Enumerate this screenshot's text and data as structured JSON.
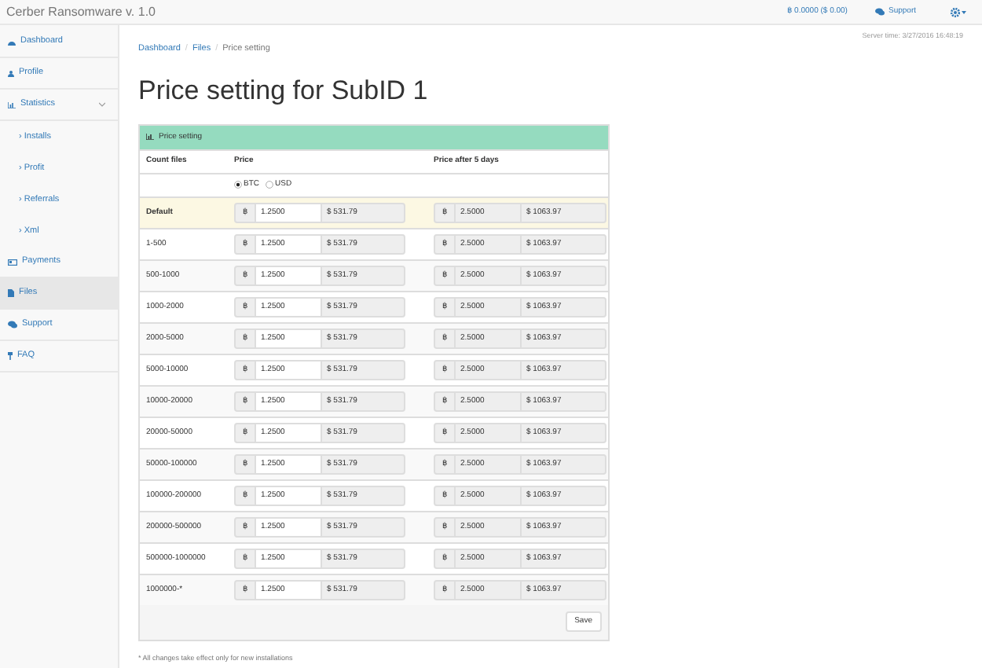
{
  "topbar": {
    "title": "Cerber Ransomware v. 1.0",
    "balance": "฿ 0.0000  ($ 0.00)",
    "support": "Support"
  },
  "sidebar": {
    "items": [
      {
        "label": "Dashboard",
        "selected": false
      },
      {
        "label": "Profile",
        "selected": false
      },
      {
        "label": "Statistics",
        "selected": false,
        "expanded": true,
        "children": [
          {
            "label": "› Installs",
            "selected": false
          },
          {
            "label": "› Profit",
            "selected": false
          },
          {
            "label": "› Referrals",
            "selected": false
          },
          {
            "label": "› Xml",
            "selected": false
          }
        ]
      },
      {
        "label": "Payments",
        "selected": false
      },
      {
        "label": "Files",
        "selected": true
      },
      {
        "label": "Support",
        "selected": false
      },
      {
        "label": "FAQ",
        "selected": false
      }
    ]
  },
  "breadcrumb": [
    {
      "label": "Dashboard",
      "link": true
    },
    {
      "label": "Files",
      "link": true
    },
    {
      "label": "Price setting",
      "link": false
    }
  ],
  "breadcrumb_separators": [
    "/",
    "/"
  ],
  "server_time": "Server time: 3/27/2016  16:48:19",
  "heading": "Price setting for SubID 1",
  "panel": {
    "title": "Price setting",
    "columns": [
      "Count files",
      "Price",
      "Price after 5 days"
    ],
    "currency": [
      {
        "label": "BTC",
        "selected": true
      },
      {
        "label": "USD",
        "selected": false
      }
    ],
    "rows": [
      {
        "count": "Default",
        "highlighted": true,
        "btc_sign": "฿",
        "price": "1.2500",
        "usd": "$ 531.79",
        "btc_sign_after": "฿",
        "price_after": "2.5000",
        "usd_after": "$ 1063.97"
      },
      {
        "count": "1-500",
        "highlighted": false,
        "btc_sign": "฿",
        "price": "1.2500",
        "usd": "$ 531.79",
        "btc_sign_after": "฿",
        "price_after": "2.5000",
        "usd_after": "$ 1063.97"
      },
      {
        "count": "500-1000",
        "highlighted": false,
        "btc_sign": "฿",
        "price": "1.2500",
        "usd": "$ 531.79",
        "btc_sign_after": "฿",
        "price_after": "2.5000",
        "usd_after": "$ 1063.97"
      },
      {
        "count": "1000-2000",
        "highlighted": false,
        "btc_sign": "฿",
        "price": "1.2500",
        "usd": "$ 531.79",
        "btc_sign_after": "฿",
        "price_after": "2.5000",
        "usd_after": "$ 1063.97"
      },
      {
        "count": "2000-5000",
        "highlighted": false,
        "btc_sign": "฿",
        "price": "1.2500",
        "usd": "$ 531.79",
        "btc_sign_after": "฿",
        "price_after": "2.5000",
        "usd_after": "$ 1063.97"
      },
      {
        "count": "5000-10000",
        "highlighted": false,
        "btc_sign": "฿",
        "price": "1.2500",
        "usd": "$ 531.79",
        "btc_sign_after": "฿",
        "price_after": "2.5000",
        "usd_after": "$ 1063.97"
      },
      {
        "count": "10000-20000",
        "highlighted": false,
        "btc_sign": "฿",
        "price": "1.2500",
        "usd": "$ 531.79",
        "btc_sign_after": "฿",
        "price_after": "2.5000",
        "usd_after": "$ 1063.97"
      },
      {
        "count": "20000-50000",
        "highlighted": false,
        "btc_sign": "฿",
        "price": "1.2500",
        "usd": "$ 531.79",
        "btc_sign_after": "฿",
        "price_after": "2.5000",
        "usd_after": "$ 1063.97"
      },
      {
        "count": "50000-100000",
        "highlighted": false,
        "btc_sign": "฿",
        "price": "1.2500",
        "usd": "$ 531.79",
        "btc_sign_after": "฿",
        "price_after": "2.5000",
        "usd_after": "$ 1063.97"
      },
      {
        "count": "100000-200000",
        "highlighted": false,
        "btc_sign": "฿",
        "price": "1.2500",
        "usd": "$ 531.79",
        "btc_sign_after": "฿",
        "price_after": "2.5000",
        "usd_after": "$ 1063.97"
      },
      {
        "count": "200000-500000",
        "highlighted": false,
        "btc_sign": "฿",
        "price": "1.2500",
        "usd": "$ 531.79",
        "btc_sign_after": "฿",
        "price_after": "2.5000",
        "usd_after": "$ 1063.97"
      },
      {
        "count": "500000-1000000",
        "highlighted": false,
        "btc_sign": "฿",
        "price": "1.2500",
        "usd": "$ 531.79",
        "btc_sign_after": "฿",
        "price_after": "2.5000",
        "usd_after": "$ 1063.97"
      },
      {
        "count": "1000000-*",
        "highlighted": false,
        "btc_sign": "฿",
        "price": "1.2500",
        "usd": "$ 531.79",
        "btc_sign_after": "฿",
        "price_after": "2.5000",
        "usd_after": "$ 1063.97"
      }
    ],
    "save": "Save"
  },
  "note": "* All changes take effect only for new installations"
}
